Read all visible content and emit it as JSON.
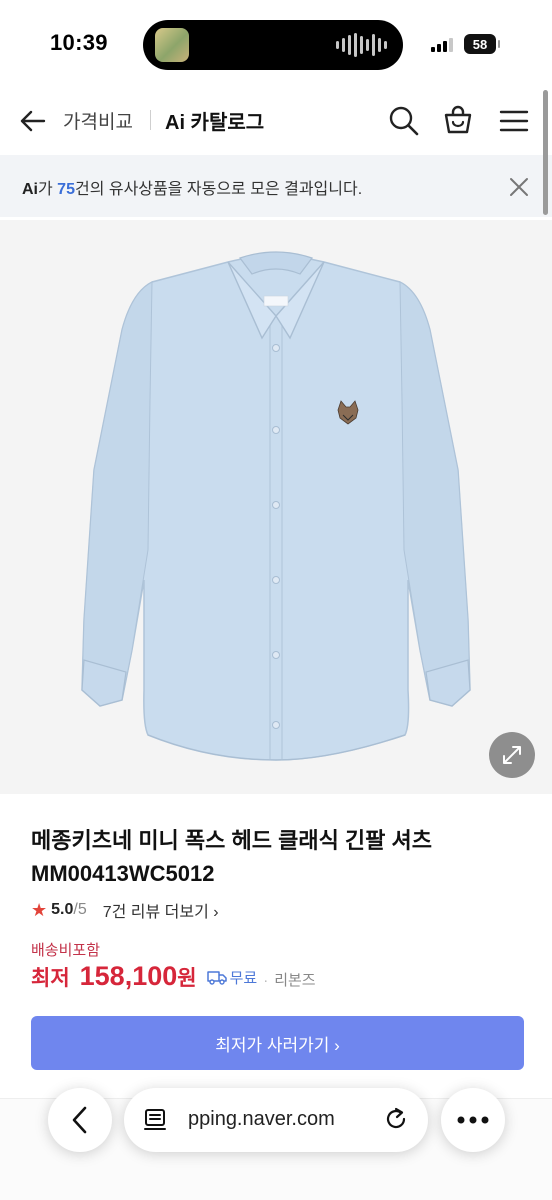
{
  "status_bar": {
    "time": "10:39",
    "battery": "58"
  },
  "header": {
    "back_icon": "arrow-left-icon",
    "crumb": "가격비교",
    "title": "Ai 카탈로그",
    "search_icon": "search-icon",
    "cart_icon": "shopping-bag-icon",
    "menu_icon": "hamburger-menu-icon"
  },
  "notice": {
    "ai_label": "Ai",
    "before_count": "가 ",
    "count": "75",
    "after_count": "건의 유사상품을 자동으로 모은 결과입니다.",
    "close_icon": "close-icon"
  },
  "product": {
    "image_description_icon": "shirt-image",
    "expand_icon": "expand-icon",
    "name": "메종키츠네 미니 폭스 헤드 클래식 긴팔 셔츠 MM00413WC5012",
    "rating_star": "★",
    "rating": "5.0",
    "rating_max": "/5",
    "review_link": "7건 리뷰 더보기 ›",
    "shipping_included": "배송비포함",
    "price_prefix": "최저",
    "price": "158,100",
    "price_unit": "원",
    "shipping_free": "무료",
    "shipping_dot": "·",
    "seller": "리본즈",
    "cta_label": "최저가 사러가기 ›"
  },
  "browser": {
    "url": "pping.naver.com",
    "back_icon": "chevron-left-icon",
    "reader_icon": "reader-mode-icon",
    "reload_icon": "reload-icon",
    "more_icon": "more-icon"
  },
  "colors": {
    "accent_blue": "#6f86ee",
    "price_red": "#d6263a",
    "count_blue": "#3a6ed8"
  }
}
